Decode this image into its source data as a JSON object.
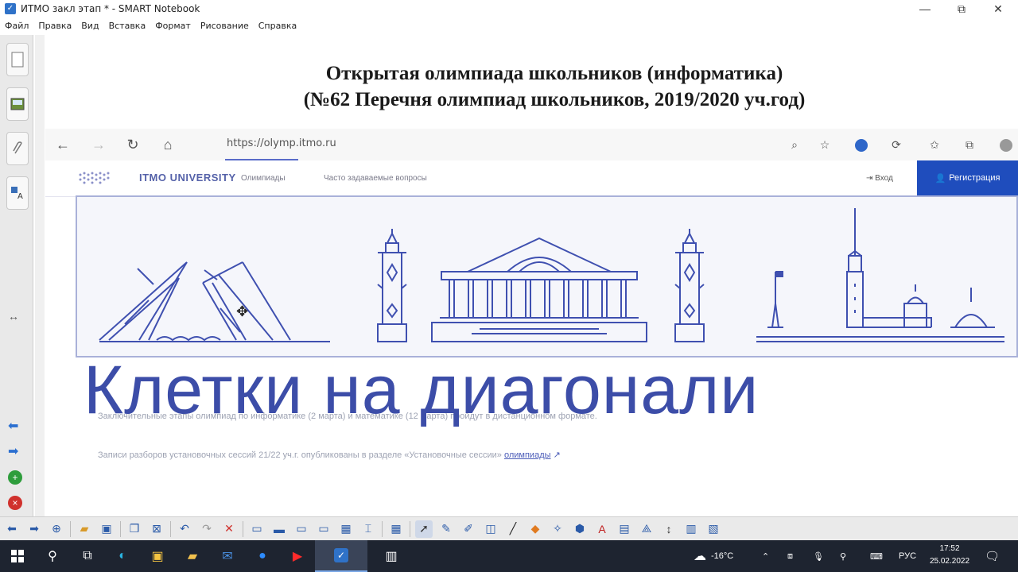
{
  "window": {
    "title": "ИТМО закл этап * - SMART Notebook",
    "minimize_label": "—",
    "maximize_label": "⧉",
    "close_label": "✕"
  },
  "menu": [
    "Файл",
    "Правка",
    "Вид",
    "Вставка",
    "Формат",
    "Рисование",
    "Справка"
  ],
  "slide": {
    "heading_line1": "Открытая олимпиада школьников (информатика)",
    "heading_line2": "(№62 Перечня олимпиад школьников, 2019/2020 уч.год)",
    "overlay_text": "Клетки на диагонали"
  },
  "browser": {
    "url": "https://olymp.itmo.ru",
    "site_logo": "ITMO UNIVERSITY",
    "nav_olympiads": "Олимпиады",
    "nav_faq": "Часто задаваемые вопросы",
    "login": "Вход",
    "register": "Регистрация",
    "notice_line1": "Заключительные этапы олимпиад по информатике (2 марта) и математике (12 марта) пройдут в дистанционном формате.",
    "notice_line2": "Записи разборов установочных сессий 21/22 уч.г. опубликованы в разделе «Установочные сессии»",
    "notice_link": "олимпиады"
  },
  "taskbar": {
    "weather": "-16°C",
    "language": "РУС",
    "time": "17:52",
    "date": "25.02.2022"
  },
  "colors": {
    "accent": "#3c4da8",
    "register_bg": "#1f4dbd",
    "taskbar_bg": "#1e2430"
  }
}
